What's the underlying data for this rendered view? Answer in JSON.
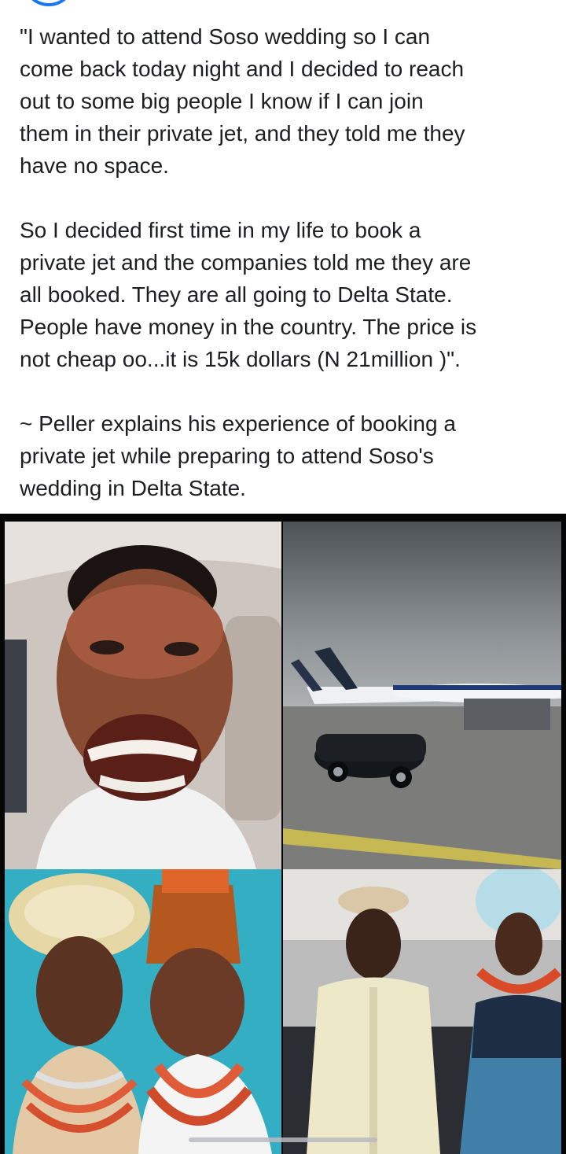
{
  "post": {
    "paragraphs": [
      "\"I wanted to attend Soso wedding so I can\ncome back today night and I decided to reach\nout to some big people I know  if I can join\nthem in their private jet, and they told me they\nhave no space.",
      "So I decided first time in my life to book a\nprivate jet and the companies told me they are\nall booked. They are all going to Delta State.\nPeople have money in the country. The price is\nnot cheap oo...it is 15k dollars (N 21million )\".",
      "~ Peller explains his experience of booking a\nprivate jet while preparing to attend Soso's\nwedding in Delta State."
    ]
  },
  "photos": [
    {
      "name": "selfie-in-car-photo"
    },
    {
      "name": "private-jet-on-tarmac-photo"
    },
    {
      "name": "couple-traditional-attire-photo"
    },
    {
      "name": "wedding-procession-photo"
    }
  ],
  "colors": {
    "text": "#1c1e21",
    "avatar_ring": "#1877f2",
    "photo_frame": "#050505"
  }
}
